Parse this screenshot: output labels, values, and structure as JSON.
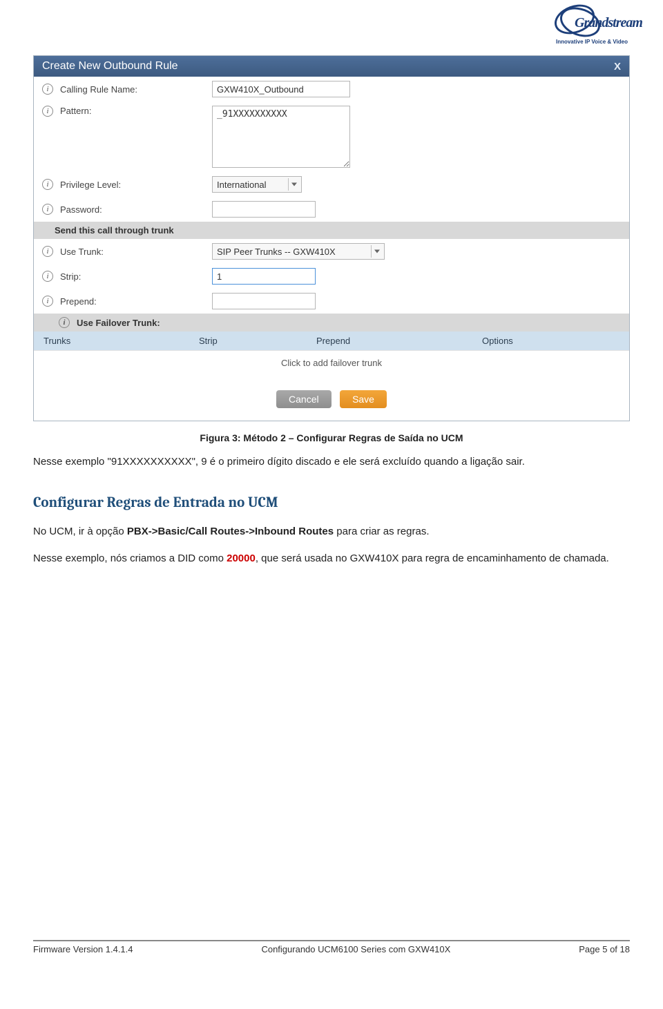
{
  "logo": {
    "brand": "Grandstream",
    "tagline": "Innovative IP Voice & Video"
  },
  "dialog": {
    "title": "Create New Outbound Rule",
    "close": "X",
    "fields": {
      "calling_rule_label": "Calling Rule Name:",
      "calling_rule_value": "GXW410X_Outbound",
      "pattern_label": "Pattern:",
      "pattern_value": "_91XXXXXXXXXX",
      "privilege_label": "Privilege Level:",
      "privilege_value": "International",
      "password_label": "Password:",
      "password_value": ""
    },
    "section_trunk": "Send this call through trunk",
    "trunk": {
      "use_label": "Use Trunk:",
      "use_value": "SIP Peer Trunks -- GXW410X",
      "strip_label": "Strip:",
      "strip_value": "1",
      "prepend_label": "Prepend:",
      "prepend_value": ""
    },
    "section_failover": "Use Failover Trunk:",
    "failover_headers": {
      "c1": "Trunks",
      "c2": "Strip",
      "c3": "Prepend",
      "c4": "Options"
    },
    "failover_click": "Click to add failover trunk",
    "buttons": {
      "cancel": "Cancel",
      "save": "Save"
    }
  },
  "caption": "Figura 3: Método 2 – Configurar Regras de Saída no UCM",
  "para1_a": "Nesse exemplo \"91XXXXXXXXXX\", 9 é o primeiro dígito discado e ele será excluído quando a ligação sair.",
  "section_title": "Configurar Regras de Entrada no UCM",
  "para2_pre": "No UCM, ir à opção ",
  "para2_bold": "PBX->Basic/Call Routes->Inbound Routes",
  "para2_post": " para criar as regras.",
  "para3_pre": "Nesse exemplo, nós criamos a DID como ",
  "para3_num": "20000",
  "para3_post": ", que será usada no GXW410X para regra de encaminhamento de chamada.",
  "footer": {
    "left": "Firmware Version 1.4.1.4",
    "center": "Configurando UCM6100 Series com GXW410X",
    "right": "Page 5 of 18"
  }
}
